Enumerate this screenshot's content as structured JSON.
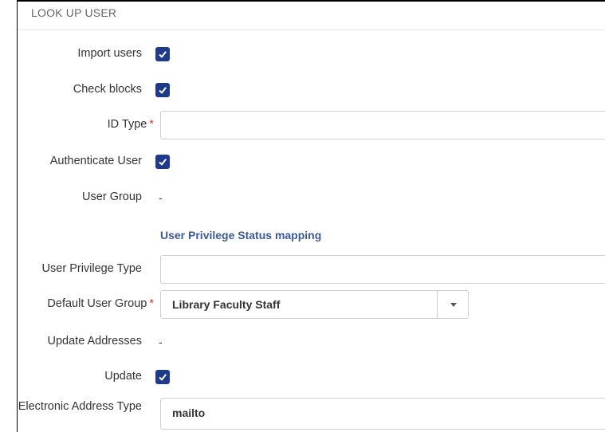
{
  "section": {
    "title": "LOOK UP USER"
  },
  "fields": {
    "import_users": {
      "label": "Import users",
      "checked": true
    },
    "check_blocks": {
      "label": "Check blocks",
      "checked": true
    },
    "id_type": {
      "label": "ID Type",
      "required_mark": "*",
      "value": ""
    },
    "authenticate_user": {
      "label": "Authenticate User",
      "checked": true
    },
    "user_group": {
      "label": "User Group",
      "value": "-"
    },
    "privilege_mapping": {
      "heading": "User Privilege Status mapping"
    },
    "user_privilege_type": {
      "label": "User Privilege Type",
      "value": ""
    },
    "default_user_group": {
      "label": "Default User Group",
      "required_mark": "*",
      "value": "Library Faculty Staff"
    },
    "update_addresses": {
      "label": "Update Addresses",
      "value": "-"
    },
    "update": {
      "label": "Update",
      "checked": true
    },
    "electronic_address_type": {
      "label": "Electronic Address Type",
      "value": "mailto"
    }
  },
  "colors": {
    "checkbox": "#1f3a8a",
    "link": "#3b5998",
    "required": "#d9383a"
  }
}
